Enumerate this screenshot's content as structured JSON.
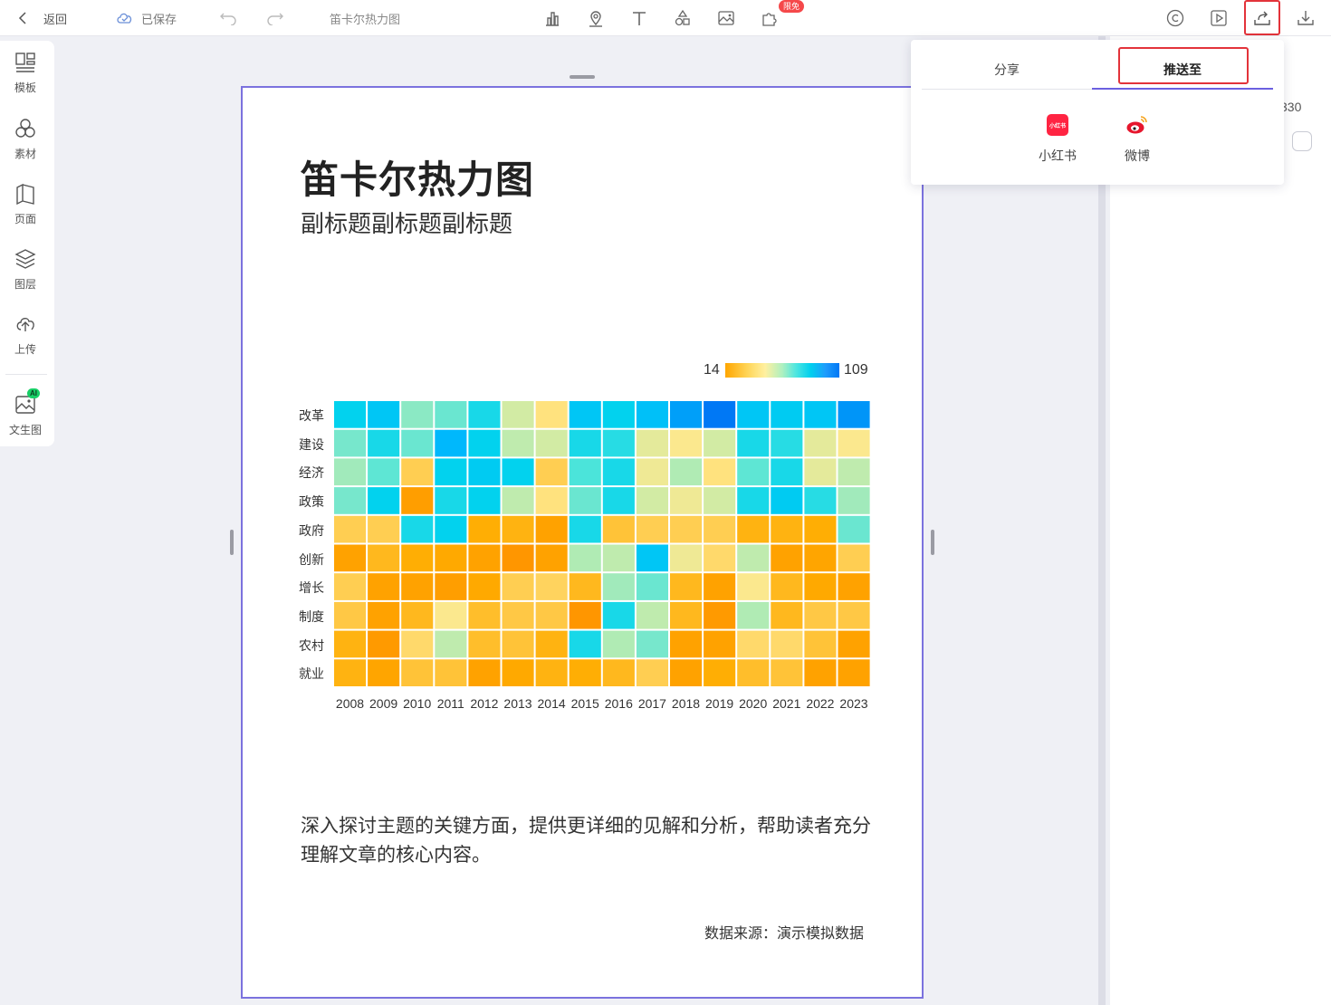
{
  "topbar": {
    "back_label": "返回",
    "saved_label": "已保存",
    "doc_title": "笛卡尔热力图",
    "new_badge": "限免",
    "tools": [
      "chart-icon",
      "map-pin-icon",
      "text-icon",
      "shapes-icon",
      "image-icon",
      "plugin-icon"
    ],
    "right_icons": [
      "copyright-icon",
      "play-icon",
      "push-icon",
      "download-icon"
    ]
  },
  "sidebar": {
    "items": [
      {
        "label": "模板",
        "icon": "template-icon"
      },
      {
        "label": "素材",
        "icon": "material-icon"
      },
      {
        "label": "页面",
        "icon": "page-icon"
      },
      {
        "label": "图层",
        "icon": "layers-icon"
      },
      {
        "label": "上传",
        "icon": "upload-icon"
      },
      {
        "label": "文生图",
        "icon": "text-to-image-icon",
        "badge": "AI"
      }
    ]
  },
  "popover": {
    "tabs": [
      "分享",
      "推送至"
    ],
    "active_tab": "推送至",
    "platforms": [
      {
        "label": "小红书",
        "logo_text": "小红书",
        "icon": "xiaohongshu-icon"
      },
      {
        "label": "微博",
        "icon": "weibo-icon"
      }
    ]
  },
  "rpanel": {
    "partial_value": "330"
  },
  "page": {
    "title": "笛卡尔热力图",
    "subtitle": "副标题副标题副标题",
    "description": "深入探讨主题的关键方面，提供更详细的见解和分析，帮助读者充分理解文章的核心内容。",
    "source": "数据来源：演示模拟数据"
  },
  "chart_data": {
    "type": "heatmap",
    "title": "笛卡尔热力图",
    "subtitle": "副标题副标题副标题",
    "x": [
      "2008",
      "2009",
      "2010",
      "2011",
      "2012",
      "2013",
      "2014",
      "2015",
      "2016",
      "2017",
      "2018",
      "2019",
      "2020",
      "2021",
      "2022",
      "2023"
    ],
    "y": [
      "改革",
      "建设",
      "经济",
      "政策",
      "政府",
      "创新",
      "增长",
      "制度",
      "农村",
      "就业"
    ],
    "color_range": [
      14,
      109
    ],
    "legend_min_label": "14",
    "legend_max_label": "109",
    "values": [
      [
        85,
        90,
        65,
        70,
        82,
        55,
        45,
        90,
        85,
        92,
        100,
        108,
        90,
        88,
        90,
        102
      ],
      [
        68,
        82,
        70,
        95,
        85,
        58,
        55,
        82,
        80,
        52,
        48,
        55,
        82,
        80,
        52,
        48
      ],
      [
        62,
        72,
        38,
        85,
        88,
        85,
        38,
        75,
        82,
        50,
        60,
        45,
        72,
        82,
        52,
        58
      ],
      [
        68,
        85,
        18,
        82,
        85,
        58,
        45,
        70,
        82,
        55,
        50,
        55,
        82,
        88,
        80,
        62
      ],
      [
        38,
        38,
        82,
        85,
        26,
        28,
        20,
        82,
        34,
        38,
        38,
        38,
        28,
        28,
        26,
        70
      ],
      [
        20,
        30,
        26,
        24,
        20,
        14,
        20,
        60,
        58,
        90,
        50,
        42,
        58,
        20,
        22,
        38
      ],
      [
        38,
        20,
        20,
        18,
        24,
        38,
        40,
        30,
        62,
        70,
        30,
        20,
        48,
        30,
        24,
        20
      ],
      [
        36,
        20,
        30,
        48,
        32,
        36,
        36,
        14,
        82,
        58,
        30,
        16,
        60,
        30,
        36,
        36
      ],
      [
        28,
        16,
        42,
        58,
        32,
        34,
        28,
        82,
        60,
        68,
        20,
        20,
        42,
        42,
        34,
        20
      ],
      [
        28,
        22,
        34,
        34,
        20,
        24,
        28,
        26,
        30,
        38,
        20,
        26,
        32,
        34,
        20,
        20
      ]
    ]
  }
}
